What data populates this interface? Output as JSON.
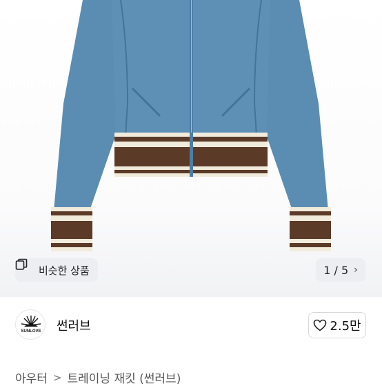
{
  "product_image": {
    "description_icon": "jacket-photo",
    "colors": {
      "jacket": "#5b8db3",
      "jacket_dark": "#44739a",
      "stripe_brown": "#5b3a28",
      "stripe_cream": "#f1ebdc"
    }
  },
  "similar_chip": {
    "label": "비슷한 상품",
    "icon": "similar-items-icon"
  },
  "counter": {
    "text": "1 / 5",
    "icon": "chevron-right-icon"
  },
  "seller": {
    "name": "썬러브",
    "avatar_text": "SUNLOVE"
  },
  "like": {
    "count": "2.5만",
    "icon": "heart-icon"
  },
  "breadcrumb": {
    "items": [
      "아우터",
      "트레이닝 재킷 (썬러브)"
    ],
    "separator": ">"
  }
}
